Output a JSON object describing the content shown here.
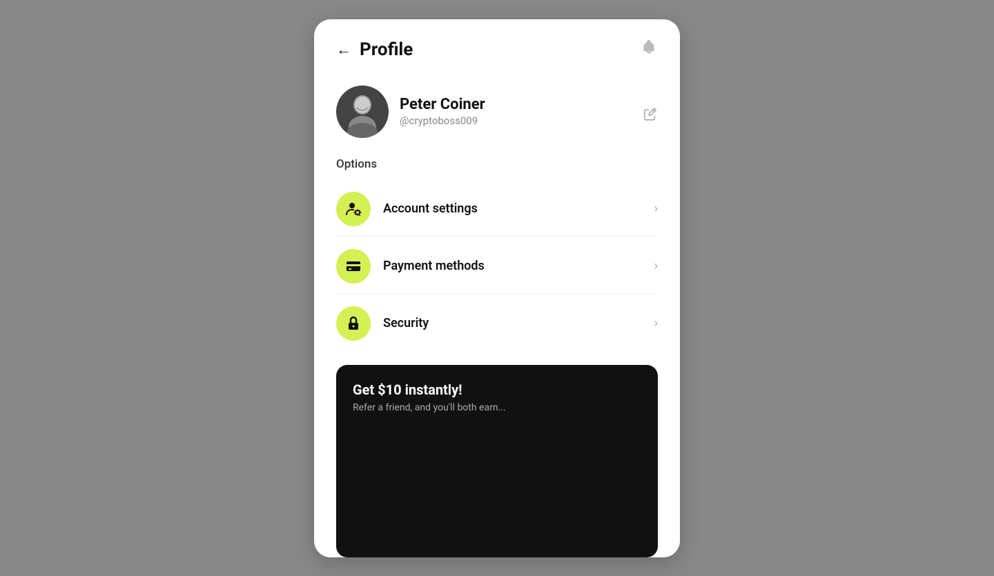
{
  "header": {
    "title": "Profile",
    "back_label": "←",
    "bell_icon": "🔔"
  },
  "profile": {
    "name": "Peter Coiner",
    "username": "@cryptoboss009",
    "edit_icon": "✏️"
  },
  "options": {
    "label": "Options",
    "items": [
      {
        "id": "account-settings",
        "label": "Account settings",
        "icon": "account"
      },
      {
        "id": "payment-methods",
        "label": "Payment methods",
        "icon": "payment"
      },
      {
        "id": "security",
        "label": "Security",
        "icon": "lock"
      }
    ]
  },
  "promo": {
    "title": "Get $10 instantly!",
    "subtitle": "Refer a friend, and you'll both earn..."
  },
  "colors": {
    "accent": "#d4f053",
    "dark": "#111111",
    "muted": "#aaaaaa"
  }
}
